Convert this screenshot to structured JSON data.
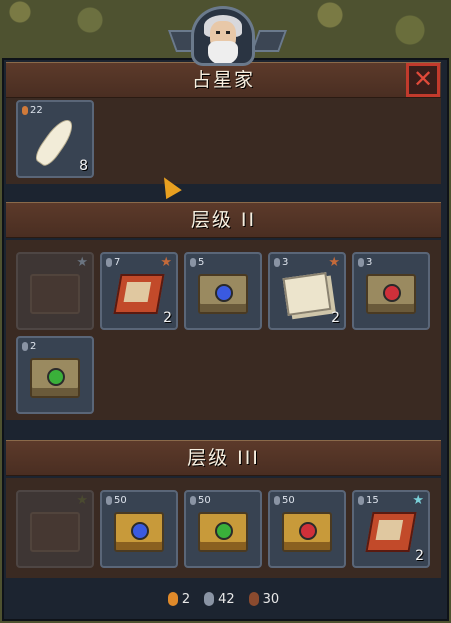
{
  "vendor": {
    "title": "占星家"
  },
  "close_button": "✕",
  "tier_sections": [
    {
      "title": "层级 II"
    },
    {
      "title": "层级 III"
    }
  ],
  "top_items": [
    {
      "kind": "feather",
      "badge": "22",
      "qty": "8"
    }
  ],
  "tier2_items": [
    {
      "kind": "locked-book",
      "badge": "",
      "qty": "",
      "star": "★",
      "star_color": "#6a7480"
    },
    {
      "kind": "red-box",
      "badge": "7",
      "qty": "2",
      "star": "★",
      "star_color": "#c46a3a"
    },
    {
      "kind": "book-blue",
      "badge": "5",
      "qty": "",
      "star": "",
      "star_color": ""
    },
    {
      "kind": "papers",
      "badge": "3",
      "qty": "2",
      "star": "★",
      "star_color": "#c46a3a"
    },
    {
      "kind": "book-red",
      "badge": "3",
      "qty": "",
      "star": "",
      "star_color": ""
    },
    {
      "kind": "book-green",
      "badge": "2",
      "qty": "",
      "star": "",
      "star_color": ""
    }
  ],
  "tier3_items": [
    {
      "kind": "locked-book",
      "badge": "",
      "qty": "",
      "star": "★",
      "star_color": "#4a4a30"
    },
    {
      "kind": "gold-book-blue",
      "badge": "50",
      "qty": "",
      "star": "",
      "star_color": ""
    },
    {
      "kind": "gold-book-green",
      "badge": "50",
      "qty": "",
      "star": "",
      "star_color": ""
    },
    {
      "kind": "gold-book-red",
      "badge": "50",
      "qty": "",
      "star": "",
      "star_color": ""
    },
    {
      "kind": "red-box",
      "badge": "15",
      "qty": "2",
      "star": "★",
      "star_color": "#7ad0d8"
    }
  ],
  "currency": [
    {
      "name": "orange-coin",
      "color": "#e08a2a",
      "value": "2"
    },
    {
      "name": "silver-coin",
      "color": "#8a94a4",
      "value": "42"
    },
    {
      "name": "bronze-coin",
      "color": "#8a4a2e",
      "value": "30"
    }
  ],
  "colors": {
    "badge_dot": "#8a94a4",
    "badge_dot_orange": "#d07a3a"
  }
}
